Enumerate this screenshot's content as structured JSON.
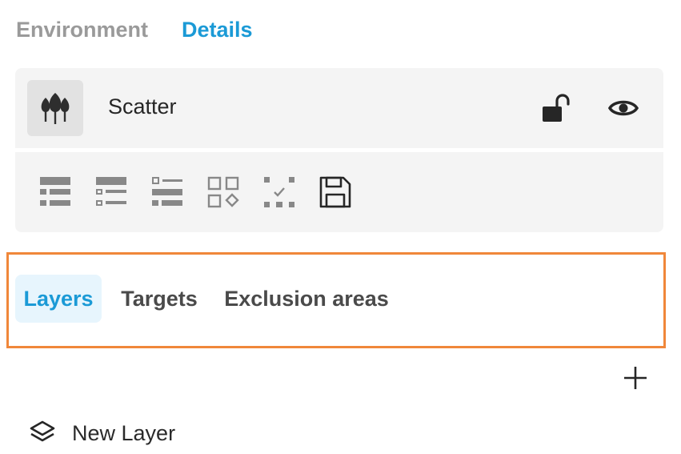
{
  "top_tabs": [
    {
      "label": "Environment",
      "active": false
    },
    {
      "label": "Details",
      "active": true
    }
  ],
  "object": {
    "name": "Scatter",
    "icon": "trees-icon",
    "lock_icon": "unlocked-padlock-icon",
    "visibility_icon": "eye-icon"
  },
  "toolbar": {
    "tools": [
      {
        "icon": "list-view-filled-icon"
      },
      {
        "icon": "list-view-detail-icon"
      },
      {
        "icon": "list-view-outline-icon"
      },
      {
        "icon": "grid-shapes-icon"
      },
      {
        "icon": "selection-check-icon"
      },
      {
        "icon": "save-icon"
      }
    ]
  },
  "sub_tabs": [
    {
      "label": "Layers",
      "active": true
    },
    {
      "label": "Targets",
      "active": false
    },
    {
      "label": "Exclusion areas",
      "active": false
    }
  ],
  "layers": {
    "add_icon": "plus-icon",
    "items": [
      {
        "label": "New Layer",
        "icon": "layers-icon"
      }
    ]
  },
  "colors": {
    "accent": "#1b9ad6",
    "highlight_border": "#f0873a",
    "panel_bg": "#f4f4f4",
    "active_tab_bg": "#e7f5fd"
  }
}
